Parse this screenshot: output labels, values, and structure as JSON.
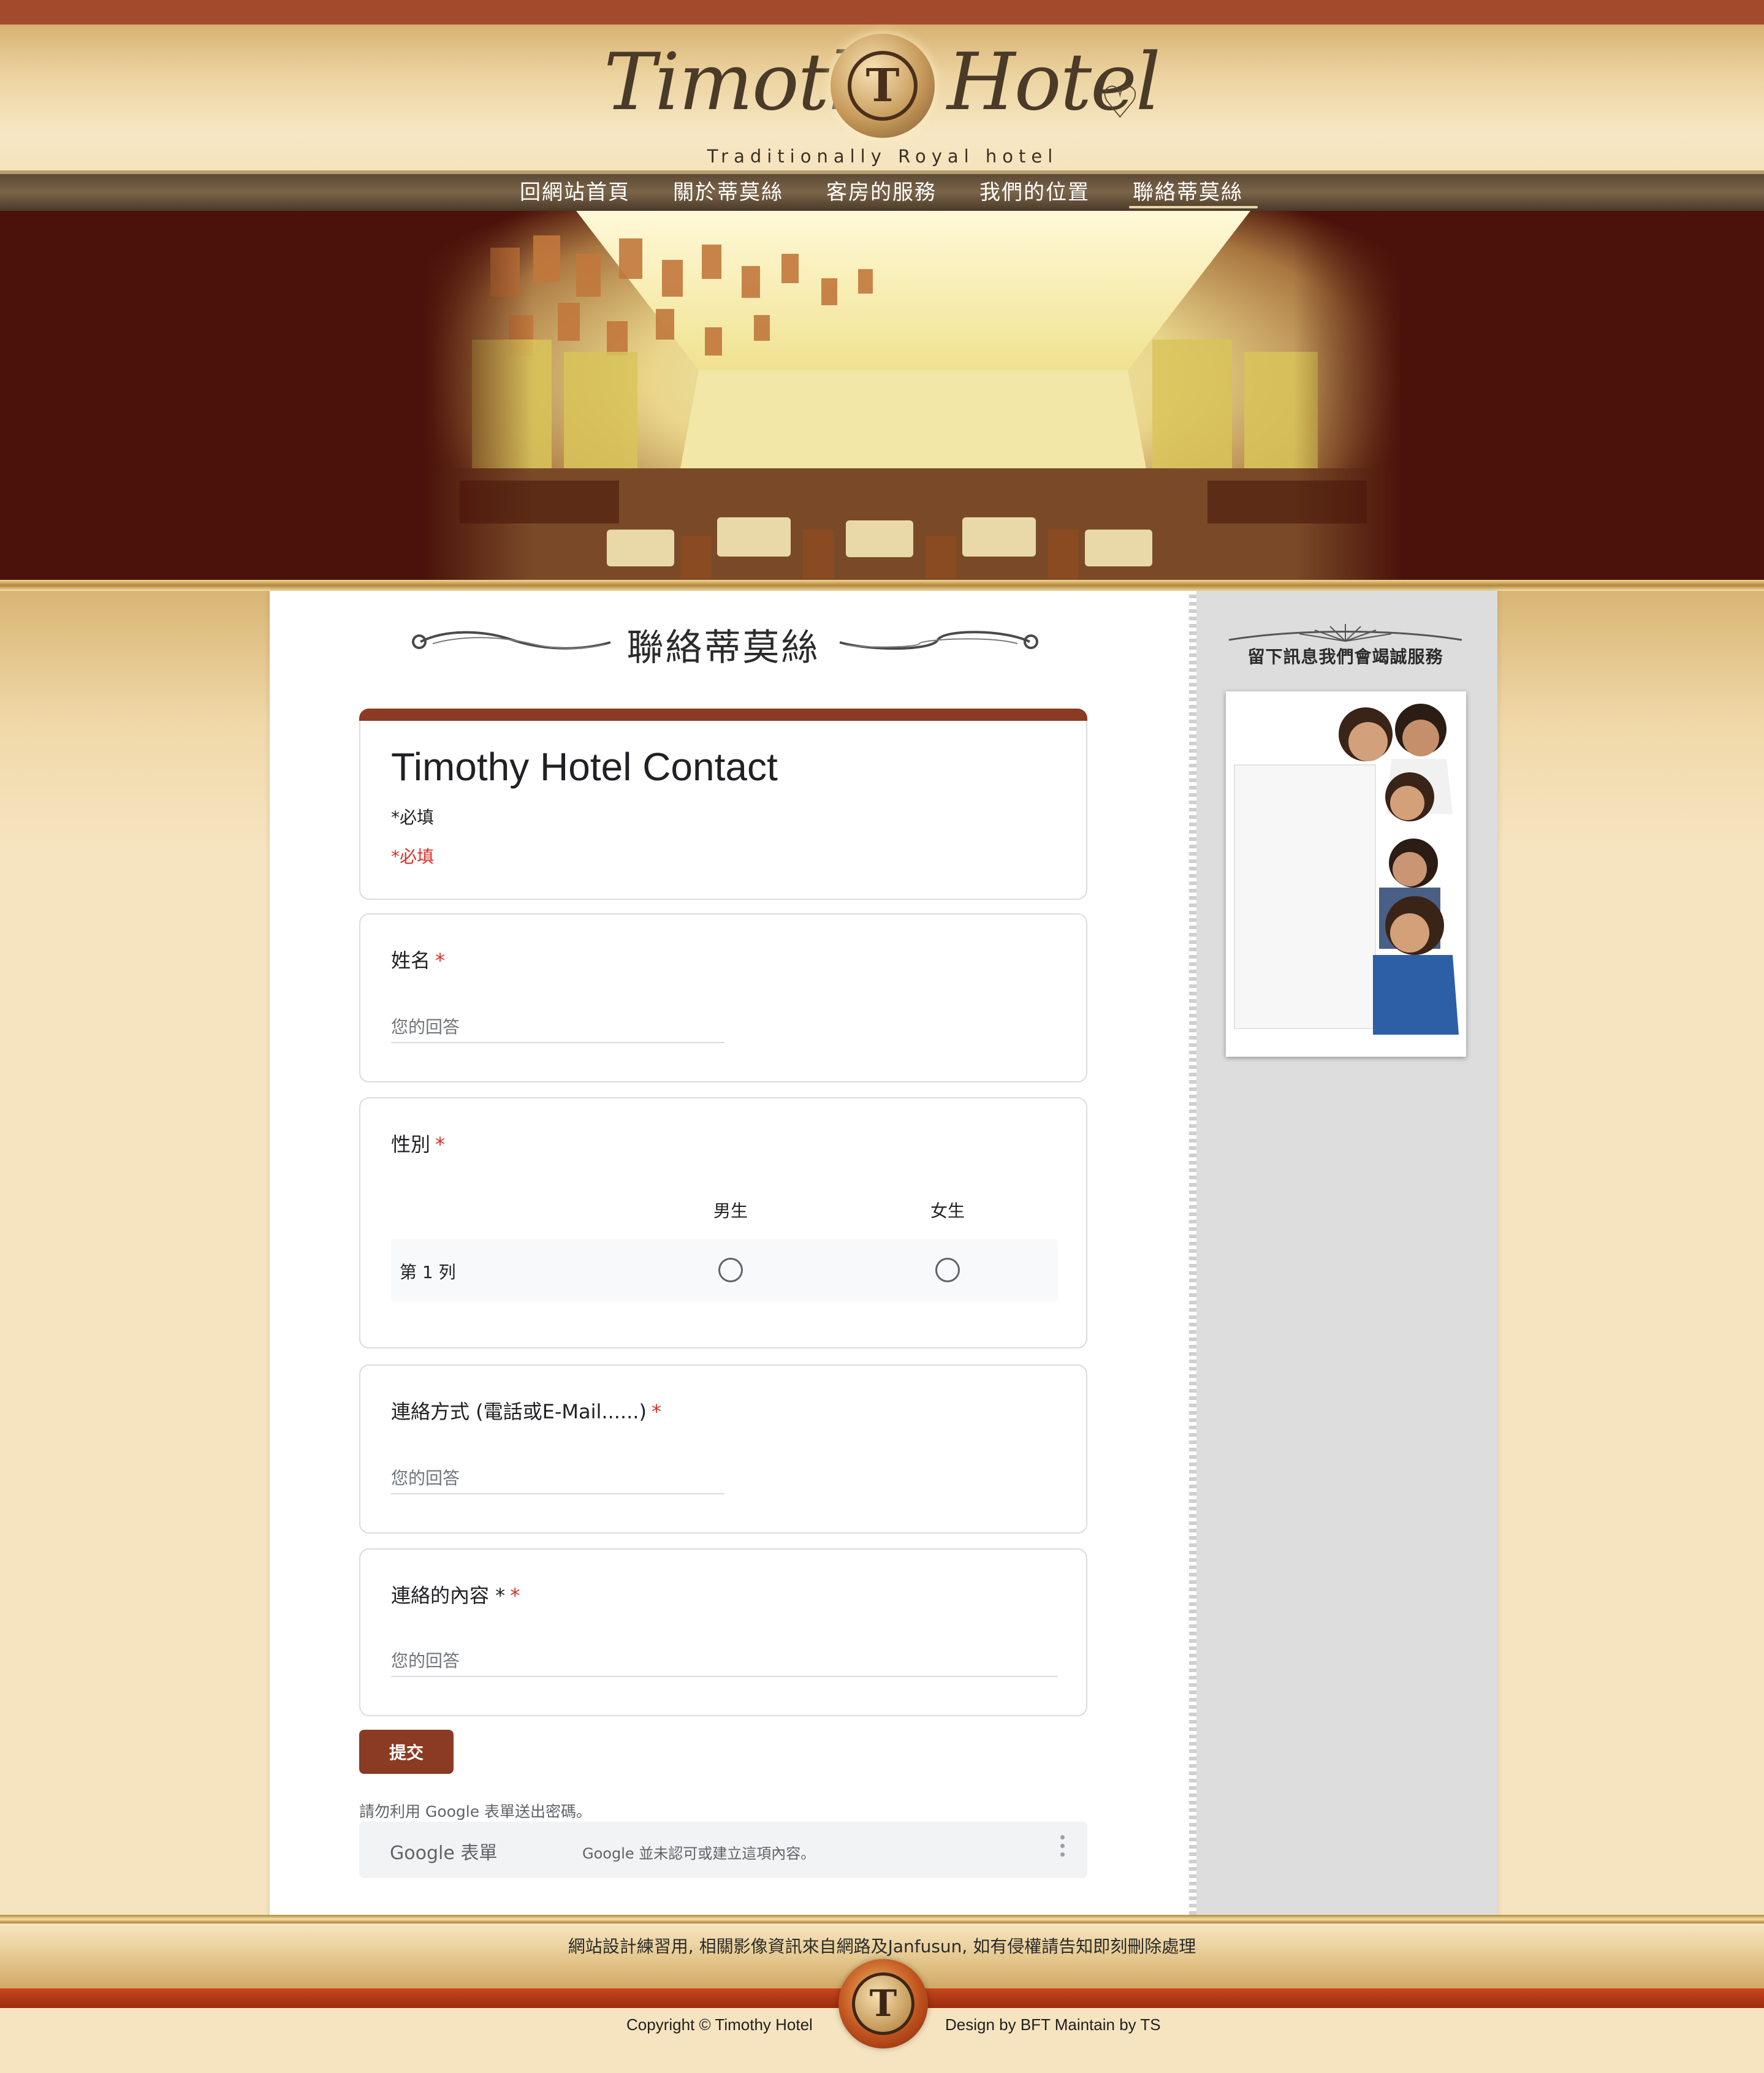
{
  "header": {
    "logo_left": "Timothy",
    "logo_right": "Hotel",
    "logo_emblem_letter": "T",
    "tagline": "Traditionally Royal hotel"
  },
  "nav": {
    "items": [
      {
        "label": "回網站首頁"
      },
      {
        "label": "關於蒂莫絲"
      },
      {
        "label": "客房的服務"
      },
      {
        "label": "我們的位置"
      },
      {
        "label": "聯絡蒂莫絲",
        "active": true
      }
    ]
  },
  "page": {
    "heading": "聯絡蒂莫絲"
  },
  "form": {
    "title": "Timothy Hotel Contact",
    "required_note": "*必填",
    "required_note_red": "*必填",
    "questions": [
      {
        "label": "姓名",
        "star": "*",
        "placeholder": "您的回答"
      },
      {
        "label": "性別",
        "star": "*",
        "columns": [
          "男生",
          "女生"
        ],
        "rows": [
          "第 1 列"
        ]
      },
      {
        "label": "連絡方式 (電話或E-Mail......)",
        "star": "*",
        "placeholder": "您的回答"
      },
      {
        "label": "連絡的內容 *",
        "star": "*",
        "placeholder": "您的回答"
      }
    ],
    "submit_label": "提交",
    "password_warning": "請勿利用 Google 表單送出密碼。",
    "google_brand": "Google 表單",
    "google_disclaimer": "Google 並未認可或建立這項內容。"
  },
  "sidebar": {
    "title": "留下訊息我們會竭誠服務"
  },
  "footer": {
    "note": "網站設計練習用, 相關影像資訊來自網路及Janfusun, 如有侵權請告知即刻刪除處理",
    "copyright": "Copyright © Timothy Hotel",
    "credit": "Design by BFT Maintain by TS",
    "emblem_letter": "T"
  },
  "colors": {
    "accent": "#8b3a24",
    "banner_bg": "#4a120a",
    "page_bg": "#f6e4c0",
    "required_red": "#d93025"
  }
}
